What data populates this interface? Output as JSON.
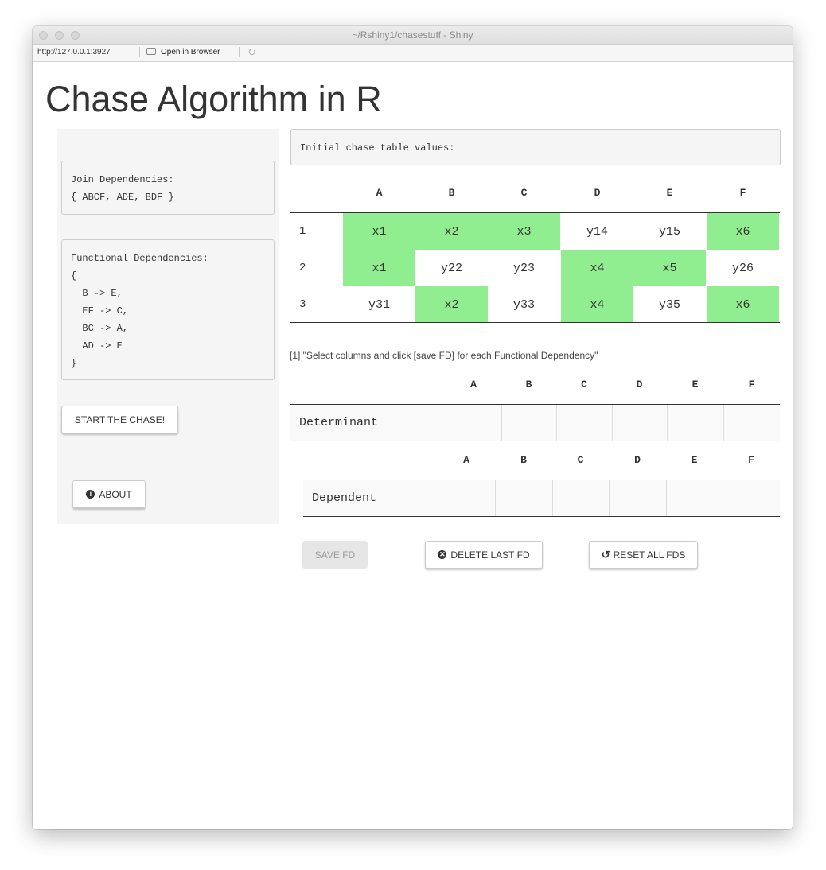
{
  "window": {
    "title": "~/Rshiny1/chasestuff - Shiny",
    "url": "http://127.0.0.1:3927",
    "open_in_browser": "Open in Browser",
    "refresh_icon": "refresh-icon"
  },
  "page": {
    "title": "Chase Algorithm in R"
  },
  "sidebar": {
    "join_text": "Join Dependencies:\n{ ABCF, ADE, BDF }",
    "functional_text": "Functional Dependencies:\n{\n  B -> E,\n  EF -> C,\n  BC -> A,\n  AD -> E\n}",
    "start_button": "START THE CHASE!",
    "about_button": "ABOUT",
    "about_icon": "info-circle-icon"
  },
  "main": {
    "initial_label": "Initial chase table values:",
    "columns": [
      "A",
      "B",
      "C",
      "D",
      "E",
      "F"
    ],
    "chase_rows": [
      {
        "label": "1",
        "cells": [
          "x1",
          "x2",
          "x3",
          "y14",
          "y15",
          "x6"
        ]
      },
      {
        "label": "2",
        "cells": [
          "x1",
          "y22",
          "y23",
          "x4",
          "x5",
          "y26"
        ]
      },
      {
        "label": "3",
        "cells": [
          "y31",
          "x2",
          "y33",
          "x4",
          "y35",
          "x6"
        ]
      }
    ],
    "highlight_color": "#90ee90",
    "instruction": "[1] \"Select columns and click [save FD] for each Functional Dependency\"",
    "determinant_label": "Determinant",
    "dependent_label": "Dependent",
    "save_button": "SAVE FD",
    "delete_button": "DELETE LAST FD",
    "delete_icon": "times-circle-icon",
    "reset_button": "RESET ALL FDS",
    "reset_icon": "undo-icon"
  }
}
